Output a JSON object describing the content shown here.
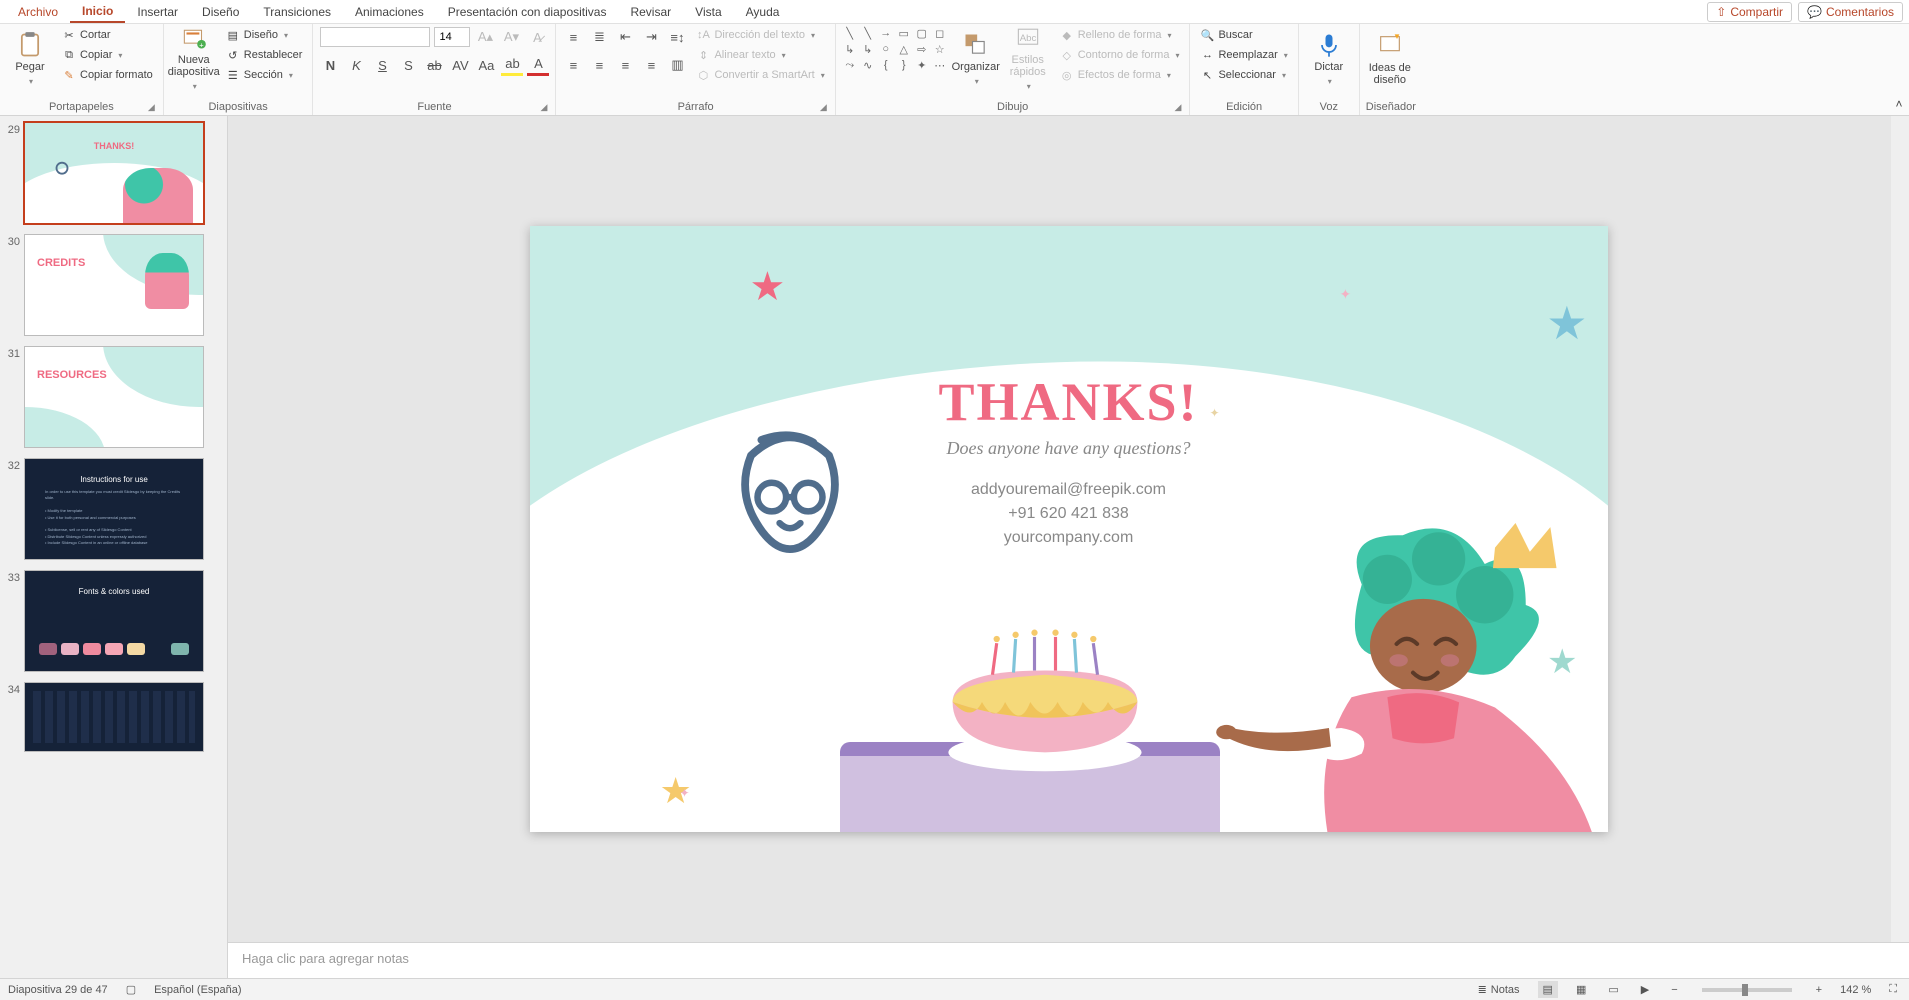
{
  "menu": {
    "file": "Archivo",
    "home": "Inicio",
    "insert": "Insertar",
    "design": "Diseño",
    "transitions": "Transiciones",
    "animations": "Animaciones",
    "slideshow": "Presentación con diapositivas",
    "review": "Revisar",
    "view": "Vista",
    "help": "Ayuda",
    "share": "Compartir",
    "comments": "Comentarios"
  },
  "ribbon": {
    "clipboard": {
      "label": "Portapapeles",
      "paste": "Pegar",
      "cut": "Cortar",
      "copy": "Copiar",
      "format_painter": "Copiar formato"
    },
    "slides": {
      "label": "Diapositivas",
      "new_slide": "Nueva diapositiva",
      "layout": "Diseño",
      "reset": "Restablecer",
      "section": "Sección"
    },
    "font": {
      "label": "Fuente",
      "size_value": "14"
    },
    "paragraph": {
      "label": "Párrafo",
      "text_direction": "Dirección del texto",
      "align_text": "Alinear texto",
      "smartart": "Convertir a SmartArt"
    },
    "drawing": {
      "label": "Dibujo",
      "arrange": "Organizar",
      "quick_styles": "Estilos rápidos",
      "shape_fill": "Relleno de forma",
      "shape_outline": "Contorno de forma",
      "shape_effects": "Efectos de forma"
    },
    "editing": {
      "label": "Edición",
      "find": "Buscar",
      "replace": "Reemplazar",
      "select": "Seleccionar"
    },
    "voice": {
      "label": "Voz",
      "dictate": "Dictar"
    },
    "designer": {
      "label": "Diseñador",
      "ideas": "Ideas de diseño"
    }
  },
  "thumbnails": {
    "items": [
      {
        "num": "29",
        "title": "THANKS!",
        "type": "light"
      },
      {
        "num": "30",
        "title": "CREDITS",
        "type": "light"
      },
      {
        "num": "31",
        "title": "RESOURCES",
        "type": "light"
      },
      {
        "num": "32",
        "title": "Instructions for use",
        "type": "dark"
      },
      {
        "num": "33",
        "title": "Fonts & colors used",
        "type": "dark"
      },
      {
        "num": "34",
        "title": "",
        "type": "dark"
      }
    ]
  },
  "slide": {
    "title": "THANKS!",
    "subtitle": "Does anyone have any questions?",
    "email": "addyouremail@freepik.com",
    "phone": "+91  620 421 838",
    "website": "yourcompany.com"
  },
  "notes": {
    "placeholder": "Haga clic para agregar notas"
  },
  "status": {
    "slide_info": "Diapositiva 29 de 47",
    "language": "Español (España)",
    "notes_btn": "Notas",
    "zoom": "142 %"
  }
}
